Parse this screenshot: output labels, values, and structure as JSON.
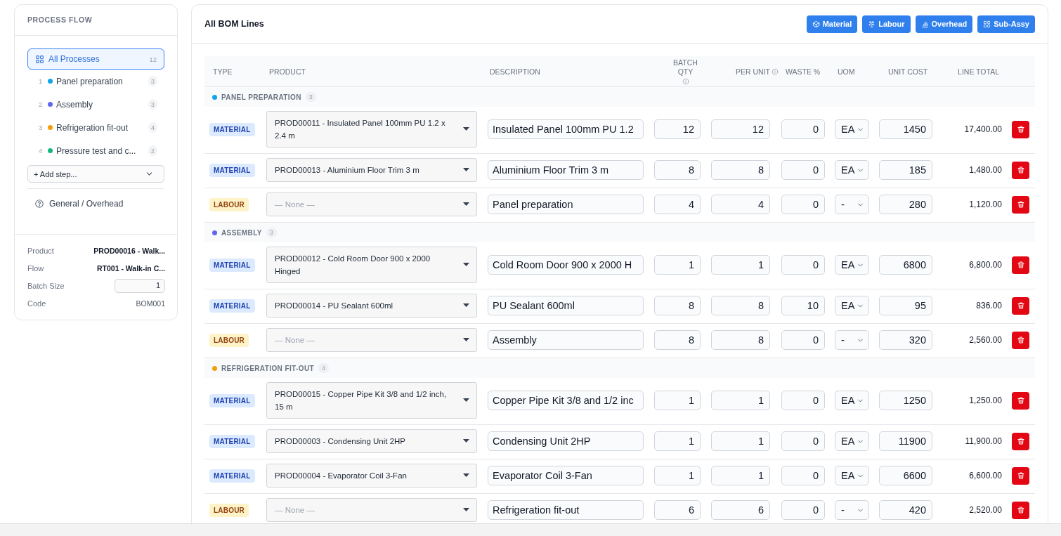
{
  "sidebar": {
    "title": "PROCESS FLOW",
    "all_item": {
      "label": "All Processes",
      "count": "12",
      "selected": true
    },
    "steps": [
      {
        "number": "1",
        "label": "Panel preparation",
        "count": "3",
        "color": "#0ea5e9",
        "selected": false
      },
      {
        "number": "2",
        "label": "Assembly",
        "count": "3",
        "color": "#6366f1",
        "selected": false
      },
      {
        "number": "3",
        "label": "Refrigeration fit-out",
        "count": "4",
        "color": "#f59e0b",
        "selected": false
      },
      {
        "number": "4",
        "label": "Pressure test and c...",
        "count": "2",
        "color": "#10b981",
        "selected": false
      }
    ],
    "add_step": "+ Add step...",
    "general_item": "General / Overhead",
    "details": [
      {
        "kind": "text",
        "label": "Product",
        "value": "PROD00016 - Walk..."
      },
      {
        "kind": "text",
        "label": "Flow",
        "value": "RT001 - Walk-in C..."
      },
      {
        "kind": "input",
        "label": "Batch Size",
        "value": "1"
      },
      {
        "kind": "muted",
        "label": "Code",
        "value": "BOM001"
      }
    ]
  },
  "main": {
    "title": "All BOM Lines",
    "buttons": [
      {
        "kind": "material",
        "label": "Material"
      },
      {
        "kind": "labour",
        "label": "Labour"
      },
      {
        "kind": "overhead",
        "label": "Overhead"
      },
      {
        "kind": "subassy",
        "label": "Sub-Assy"
      }
    ],
    "columns": [
      {
        "label": "TYPE",
        "info": false
      },
      {
        "label": "PRODUCT",
        "info": false
      },
      {
        "label": "DESCRIPTION",
        "info": false
      },
      {
        "label": "BATCH QTY",
        "info": true
      },
      {
        "label": "PER UNIT",
        "info": true
      },
      {
        "label": "WASTE %",
        "info": false
      },
      {
        "label": "UOM",
        "info": false
      },
      {
        "label": "UNIT COST",
        "info": false
      },
      {
        "label": "LINE TOTAL",
        "info": false
      }
    ],
    "groups": [
      {
        "name": "PANEL PREPARATION",
        "count": "3",
        "color": "#0ea5e9",
        "lines": [
          {
            "kind": "material",
            "type": "MATERIAL",
            "product": "PROD00011 - Insulated Panel 100mm PU 1.2 x 2.4 m",
            "description": "Insulated Panel 100mm PU 1.2",
            "batch_qty": "12",
            "per_unit": "12",
            "waste": "0",
            "uom": "EA",
            "unit_cost": "1450",
            "line_total": "17,400.00"
          },
          {
            "kind": "material",
            "type": "MATERIAL",
            "product": "PROD00013 - Aluminium Floor Trim 3 m",
            "description": "Aluminium Floor Trim 3 m",
            "batch_qty": "8",
            "per_unit": "8",
            "waste": "0",
            "uom": "EA",
            "unit_cost": "185",
            "line_total": "1,480.00"
          },
          {
            "kind": "labour",
            "type": "LABOUR",
            "product_placeholder": "— None —",
            "description": "Panel preparation",
            "batch_qty": "4",
            "per_unit": "4",
            "waste": "0",
            "uom": "-",
            "unit_cost": "280",
            "line_total": "1,120.00"
          }
        ]
      },
      {
        "name": "ASSEMBLY",
        "count": "3",
        "color": "#6366f1",
        "lines": [
          {
            "kind": "material",
            "type": "MATERIAL",
            "product": "PROD00012 - Cold Room Door 900 x 2000 Hinged",
            "description": "Cold Room Door 900 x 2000 H",
            "batch_qty": "1",
            "per_unit": "1",
            "waste": "0",
            "uom": "EA",
            "unit_cost": "6800",
            "line_total": "6,800.00"
          },
          {
            "kind": "material",
            "type": "MATERIAL",
            "product": "PROD00014 - PU Sealant 600ml",
            "description": "PU Sealant 600ml",
            "batch_qty": "8",
            "per_unit": "8",
            "waste": "10",
            "uom": "EA",
            "unit_cost": "95",
            "line_total": "836.00"
          },
          {
            "kind": "labour",
            "type": "LABOUR",
            "product_placeholder": "— None —",
            "description": "Assembly",
            "batch_qty": "8",
            "per_unit": "8",
            "waste": "0",
            "uom": "-",
            "unit_cost": "320",
            "line_total": "2,560.00"
          }
        ]
      },
      {
        "name": "REFRIGERATION FIT-OUT",
        "count": "4",
        "color": "#f59e0b",
        "lines": [
          {
            "kind": "material",
            "type": "MATERIAL",
            "product": "PROD00015 - Copper Pipe Kit 3/8 and 1/2 inch, 15 m",
            "description": "Copper Pipe Kit 3/8 and 1/2 inc",
            "batch_qty": "1",
            "per_unit": "1",
            "waste": "0",
            "uom": "EA",
            "unit_cost": "1250",
            "line_total": "1,250.00"
          },
          {
            "kind": "material",
            "type": "MATERIAL",
            "product": "PROD00003 - Condensing Unit 2HP",
            "description": "Condensing Unit 2HP",
            "batch_qty": "1",
            "per_unit": "1",
            "waste": "0",
            "uom": "EA",
            "unit_cost": "11900",
            "line_total": "11,900.00"
          },
          {
            "kind": "material",
            "type": "MATERIAL",
            "product": "PROD00004 - Evaporator Coil 3-Fan",
            "description": "Evaporator Coil 3-Fan",
            "batch_qty": "1",
            "per_unit": "1",
            "waste": "0",
            "uom": "EA",
            "unit_cost": "6600",
            "line_total": "6,600.00"
          },
          {
            "kind": "labour",
            "type": "LABOUR",
            "product_placeholder": "— None —",
            "description": "Refrigeration fit-out",
            "batch_qty": "6",
            "per_unit": "6",
            "waste": "0",
            "uom": "-",
            "unit_cost": "420",
            "line_total": "2,520.00"
          }
        ]
      }
    ]
  }
}
